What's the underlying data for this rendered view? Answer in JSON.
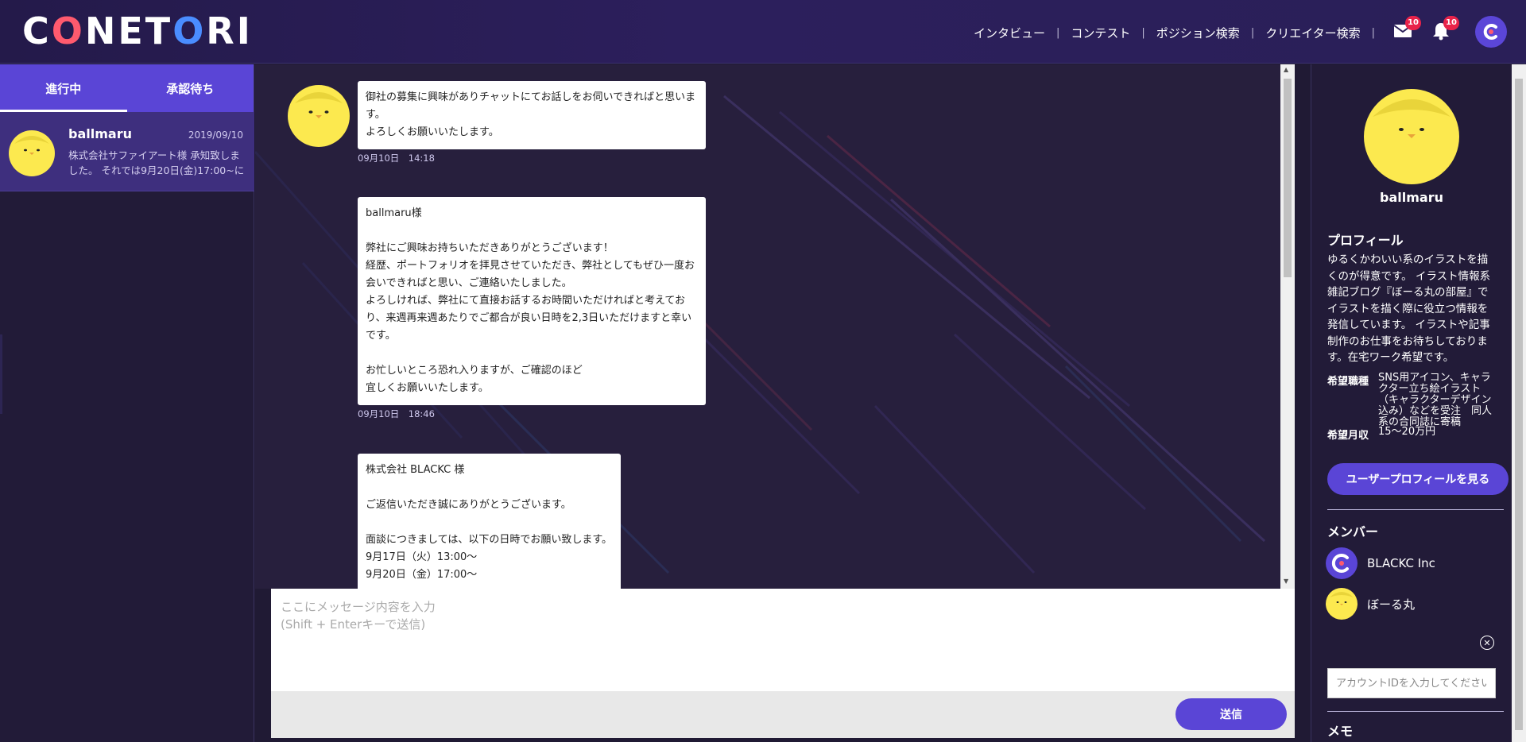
{
  "header": {
    "logo": {
      "part1": "C",
      "part2": "O",
      "part3": "NE",
      "part4": "T",
      "part5": "O",
      "part6": "RI"
    },
    "nav": [
      {
        "label": "インタビュー"
      },
      {
        "label": "コンテスト"
      },
      {
        "label": "ポジション検索"
      },
      {
        "label": "クリエイター検索"
      }
    ],
    "mail_badge": "10",
    "bell_badge": "10"
  },
  "left": {
    "tabs": [
      {
        "label": "進行中"
      },
      {
        "label": "承認待ち"
      }
    ],
    "conversations": [
      {
        "name": "ballmaru",
        "date": "2019/09/10",
        "preview": "株式会社サファイアート様 承知致しました。 それでは9月20日(金)17:00~に"
      }
    ]
  },
  "chat": {
    "messages": [
      {
        "text": "御社の募集に興味がありチャットにてお話しをお伺いできればと思います。\nよろしくお願いいたします。",
        "time": "09月10日　14:18"
      },
      {
        "text": "ballmaru様\n\n弊社にご興味お持ちいただきありがとうございます！\n経歴、ポートフォリオを拝見させていただき、弊社としてもぜひ一度お会いできればと思い、ご連絡いたしました。\nよろしければ、弊社にて直接お話するお時間いただければと考えており、来週再来週あたりでご都合が良い日時を2,3日いただけますと幸いです。\n\nお忙しいところ恐れ入りますが、ご確認のほど\n宜しくお願いいたします。",
        "time": "09月10日　18:46"
      },
      {
        "text": "株式会社 BLACKC 様\n\nご返信いただき誠にありがとうございます。\n\n面談につきましては、以下の日時でお願い致します。\n9月17日（火）13:00〜\n9月20日（金）17:00〜",
        "time": ""
      }
    ]
  },
  "input": {
    "placeholder": "ここにメッセージ内容を入力\n(Shift + Enterキーで送信)",
    "send_label": "送信"
  },
  "profile": {
    "name": "ballmaru",
    "profile_heading": "プロフィール",
    "bio": "ゆるくかわいい系のイラストを描くのが得意です。 イラスト情報系雑記ブログ『ぼーる丸の部屋』でイラストを描く際に役立つ情報を発信しています。 イラストや記事制作のお仕事をお待ちしております。在宅ワーク希望です。",
    "desired_job_label": "希望職種",
    "desired_job": "SNS用アイコン、キャラクター立ち絵イラスト（キャラクターデザイン込み）などを受注　同人系の合同誌に寄稿",
    "desired_salary_label": "希望月収",
    "desired_salary": "15〜20万円",
    "view_profile_button": "ユーザープロフィールを見る",
    "members_heading": "メンバー",
    "members": [
      {
        "name": "BLACKC Inc"
      },
      {
        "name": "ぼーる丸"
      }
    ],
    "account_placeholder": "アカウントIDを入力してください",
    "memo_heading": "メモ"
  },
  "colors": {
    "accent": "#5a45d6",
    "header_bg": "#2a1f58",
    "badge": "#e8234a",
    "chick_yellow": "#fce94f"
  }
}
